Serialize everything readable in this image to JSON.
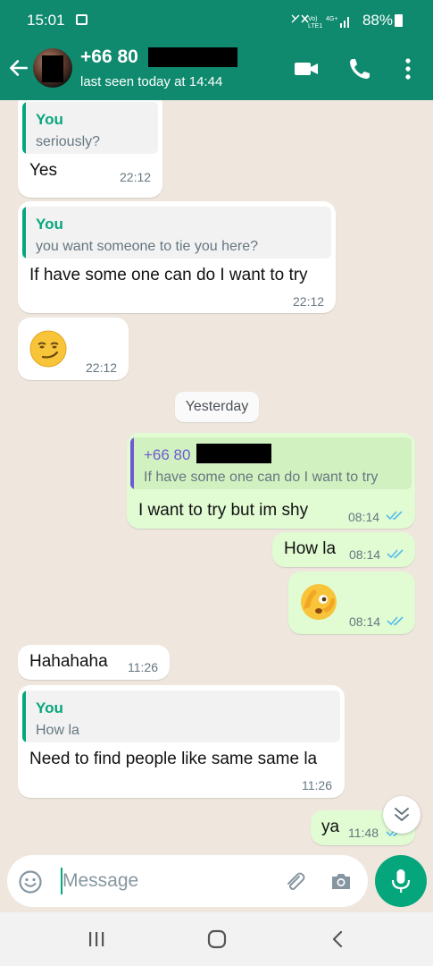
{
  "status_bar": {
    "time": "15:01",
    "network": "Vo) 4G+ LTE1",
    "battery": "88%"
  },
  "header": {
    "contact_name": "+66 80",
    "last_seen": "last seen today at 14:44"
  },
  "messages": [
    {
      "direction": "in",
      "quote_name": "You",
      "quote_text": "seriously?",
      "text": "Yes",
      "time": "22:12"
    },
    {
      "direction": "in",
      "quote_name": "You",
      "quote_text": "you want someone to tie you here?",
      "text": "If have some one can do I want to try",
      "time": "22:12"
    },
    {
      "direction": "in",
      "emoji": "smirking-face",
      "time": "22:12"
    },
    {
      "direction": "out",
      "quote_name": "+66 80",
      "quote_text": "If have some one can do I want to try",
      "text": "I want to try but im shy",
      "time": "08:14",
      "status": "read"
    },
    {
      "direction": "out",
      "text": "How la",
      "time": "08:14",
      "status": "read"
    },
    {
      "direction": "out",
      "emoji": "face-with-peeking-eye",
      "time": "08:14",
      "status": "read"
    },
    {
      "direction": "in",
      "text": "Hahahaha",
      "time": "11:26"
    },
    {
      "direction": "in",
      "quote_name": "You",
      "quote_text": "How la",
      "text": "Need to find people like same same la",
      "time": "11:26"
    },
    {
      "direction": "out",
      "text": "ya",
      "time": "11:48",
      "status": "read"
    }
  ],
  "date_divider": "Yesterday",
  "composer": {
    "placeholder": "Message"
  },
  "colors": {
    "header": "#0f8a6f",
    "accent": "#06a67d",
    "outgoing_bubble": "#e1fbd3",
    "incoming_bubble": "#ffffff",
    "chat_background": "#efe7de",
    "read_ticks": "#53bdeb"
  },
  "icons": [
    "back-arrow-icon",
    "video-call-icon",
    "phone-icon",
    "more-options-icon",
    "emoji-icon",
    "attach-icon",
    "camera-icon",
    "mic-icon",
    "chevron-down-double-icon",
    "recent-apps-icon",
    "home-icon",
    "nav-back-icon"
  ]
}
